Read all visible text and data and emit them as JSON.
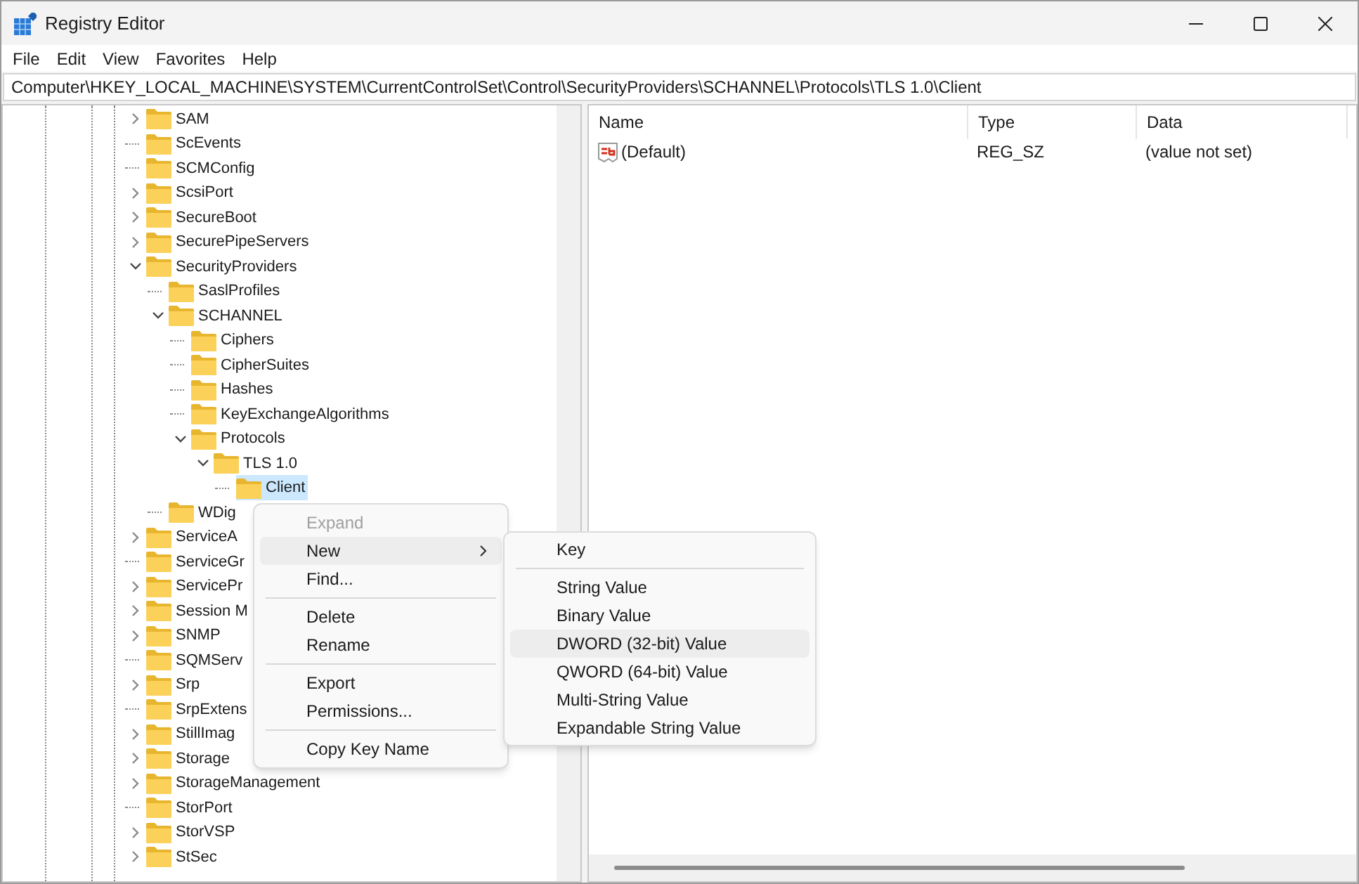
{
  "window": {
    "title": "Registry Editor"
  },
  "menu_bar": [
    "File",
    "Edit",
    "View",
    "Favorites",
    "Help"
  ],
  "address_bar": {
    "value": "Computer\\HKEY_LOCAL_MACHINE\\SYSTEM\\CurrentControlSet\\Control\\SecurityProviders\\SCHANNEL\\Protocols\\TLS 1.0\\Client"
  },
  "tree": {
    "items": [
      {
        "label": "SAM",
        "expanded": false,
        "selected": false
      },
      {
        "label": "ScEvents",
        "selected": false
      },
      {
        "label": "SCMConfig",
        "selected": false
      },
      {
        "label": "ScsiPort",
        "expanded": false,
        "selected": false
      },
      {
        "label": "SecureBoot",
        "expanded": false,
        "selected": false
      },
      {
        "label": "SecurePipeServers",
        "expanded": false,
        "selected": false
      },
      {
        "label": "SecurityProviders",
        "expanded": true,
        "selected": false,
        "children": [
          {
            "label": "SaslProfiles",
            "selected": false
          },
          {
            "label": "SCHANNEL",
            "expanded": true,
            "selected": false,
            "children": [
              {
                "label": "Ciphers",
                "selected": false
              },
              {
                "label": "CipherSuites",
                "selected": false
              },
              {
                "label": "Hashes",
                "selected": false
              },
              {
                "label": "KeyExchangeAlgorithms",
                "selected": false
              },
              {
                "label": "Protocols",
                "expanded": true,
                "selected": false,
                "children": [
                  {
                    "label": "TLS 1.0",
                    "expanded": true,
                    "selected": false,
                    "children": [
                      {
                        "label": "Client",
                        "selected": true
                      }
                    ]
                  }
                ]
              }
            ]
          },
          {
            "label": "WDig",
            "selected": false
          }
        ]
      },
      {
        "label": "ServiceA",
        "expanded": false,
        "selected": false
      },
      {
        "label": "ServiceGr",
        "selected": false
      },
      {
        "label": "ServicePr",
        "expanded": false,
        "selected": false
      },
      {
        "label": "Session M",
        "expanded": false,
        "selected": false
      },
      {
        "label": "SNMP",
        "expanded": false,
        "selected": false
      },
      {
        "label": "SQMServ",
        "selected": false
      },
      {
        "label": "Srp",
        "expanded": false,
        "selected": false
      },
      {
        "label": "SrpExtens",
        "selected": false
      },
      {
        "label": "StillImag",
        "expanded": false,
        "selected": false
      },
      {
        "label": "Storage",
        "expanded": false,
        "selected": false
      },
      {
        "label": "StorageManagement",
        "expanded": false,
        "selected": false
      },
      {
        "label": "StorPort",
        "selected": false
      },
      {
        "label": "StorVSP",
        "expanded": false,
        "selected": false
      },
      {
        "label": "StSec",
        "expanded": false,
        "selected": false
      }
    ]
  },
  "values_table": {
    "columns": [
      "Name",
      "Type",
      "Data"
    ],
    "rows": [
      {
        "name": "(Default)",
        "type": "REG_SZ",
        "data": "(value not set)"
      }
    ]
  },
  "context_menu": {
    "items": [
      {
        "kind": "item",
        "label": "Expand",
        "disabled": true,
        "selected": false
      },
      {
        "kind": "item",
        "label": "New",
        "disabled": false,
        "selected": true,
        "submenu": true
      },
      {
        "kind": "item",
        "label": "Find...",
        "disabled": false,
        "selected": false
      },
      {
        "kind": "separator"
      },
      {
        "kind": "item",
        "label": "Delete",
        "disabled": false,
        "selected": false
      },
      {
        "kind": "item",
        "label": "Rename",
        "disabled": false,
        "selected": false
      },
      {
        "kind": "separator"
      },
      {
        "kind": "item",
        "label": "Export",
        "disabled": false,
        "selected": false
      },
      {
        "kind": "item",
        "label": "Permissions...",
        "disabled": false,
        "selected": false
      },
      {
        "kind": "separator"
      },
      {
        "kind": "item",
        "label": "Copy Key Name",
        "disabled": false,
        "selected": false
      }
    ]
  },
  "submenu": {
    "items": [
      {
        "kind": "item",
        "label": "Key",
        "selected": false
      },
      {
        "kind": "separator"
      },
      {
        "kind": "item",
        "label": "String Value",
        "selected": false
      },
      {
        "kind": "item",
        "label": "Binary Value",
        "selected": false
      },
      {
        "kind": "item",
        "label": "DWORD (32-bit) Value",
        "selected": true
      },
      {
        "kind": "item",
        "label": "QWORD (64-bit) Value",
        "selected": false
      },
      {
        "kind": "item",
        "label": "Multi-String Value",
        "selected": false
      },
      {
        "kind": "item",
        "label": "Expandable String Value",
        "selected": false
      }
    ]
  }
}
